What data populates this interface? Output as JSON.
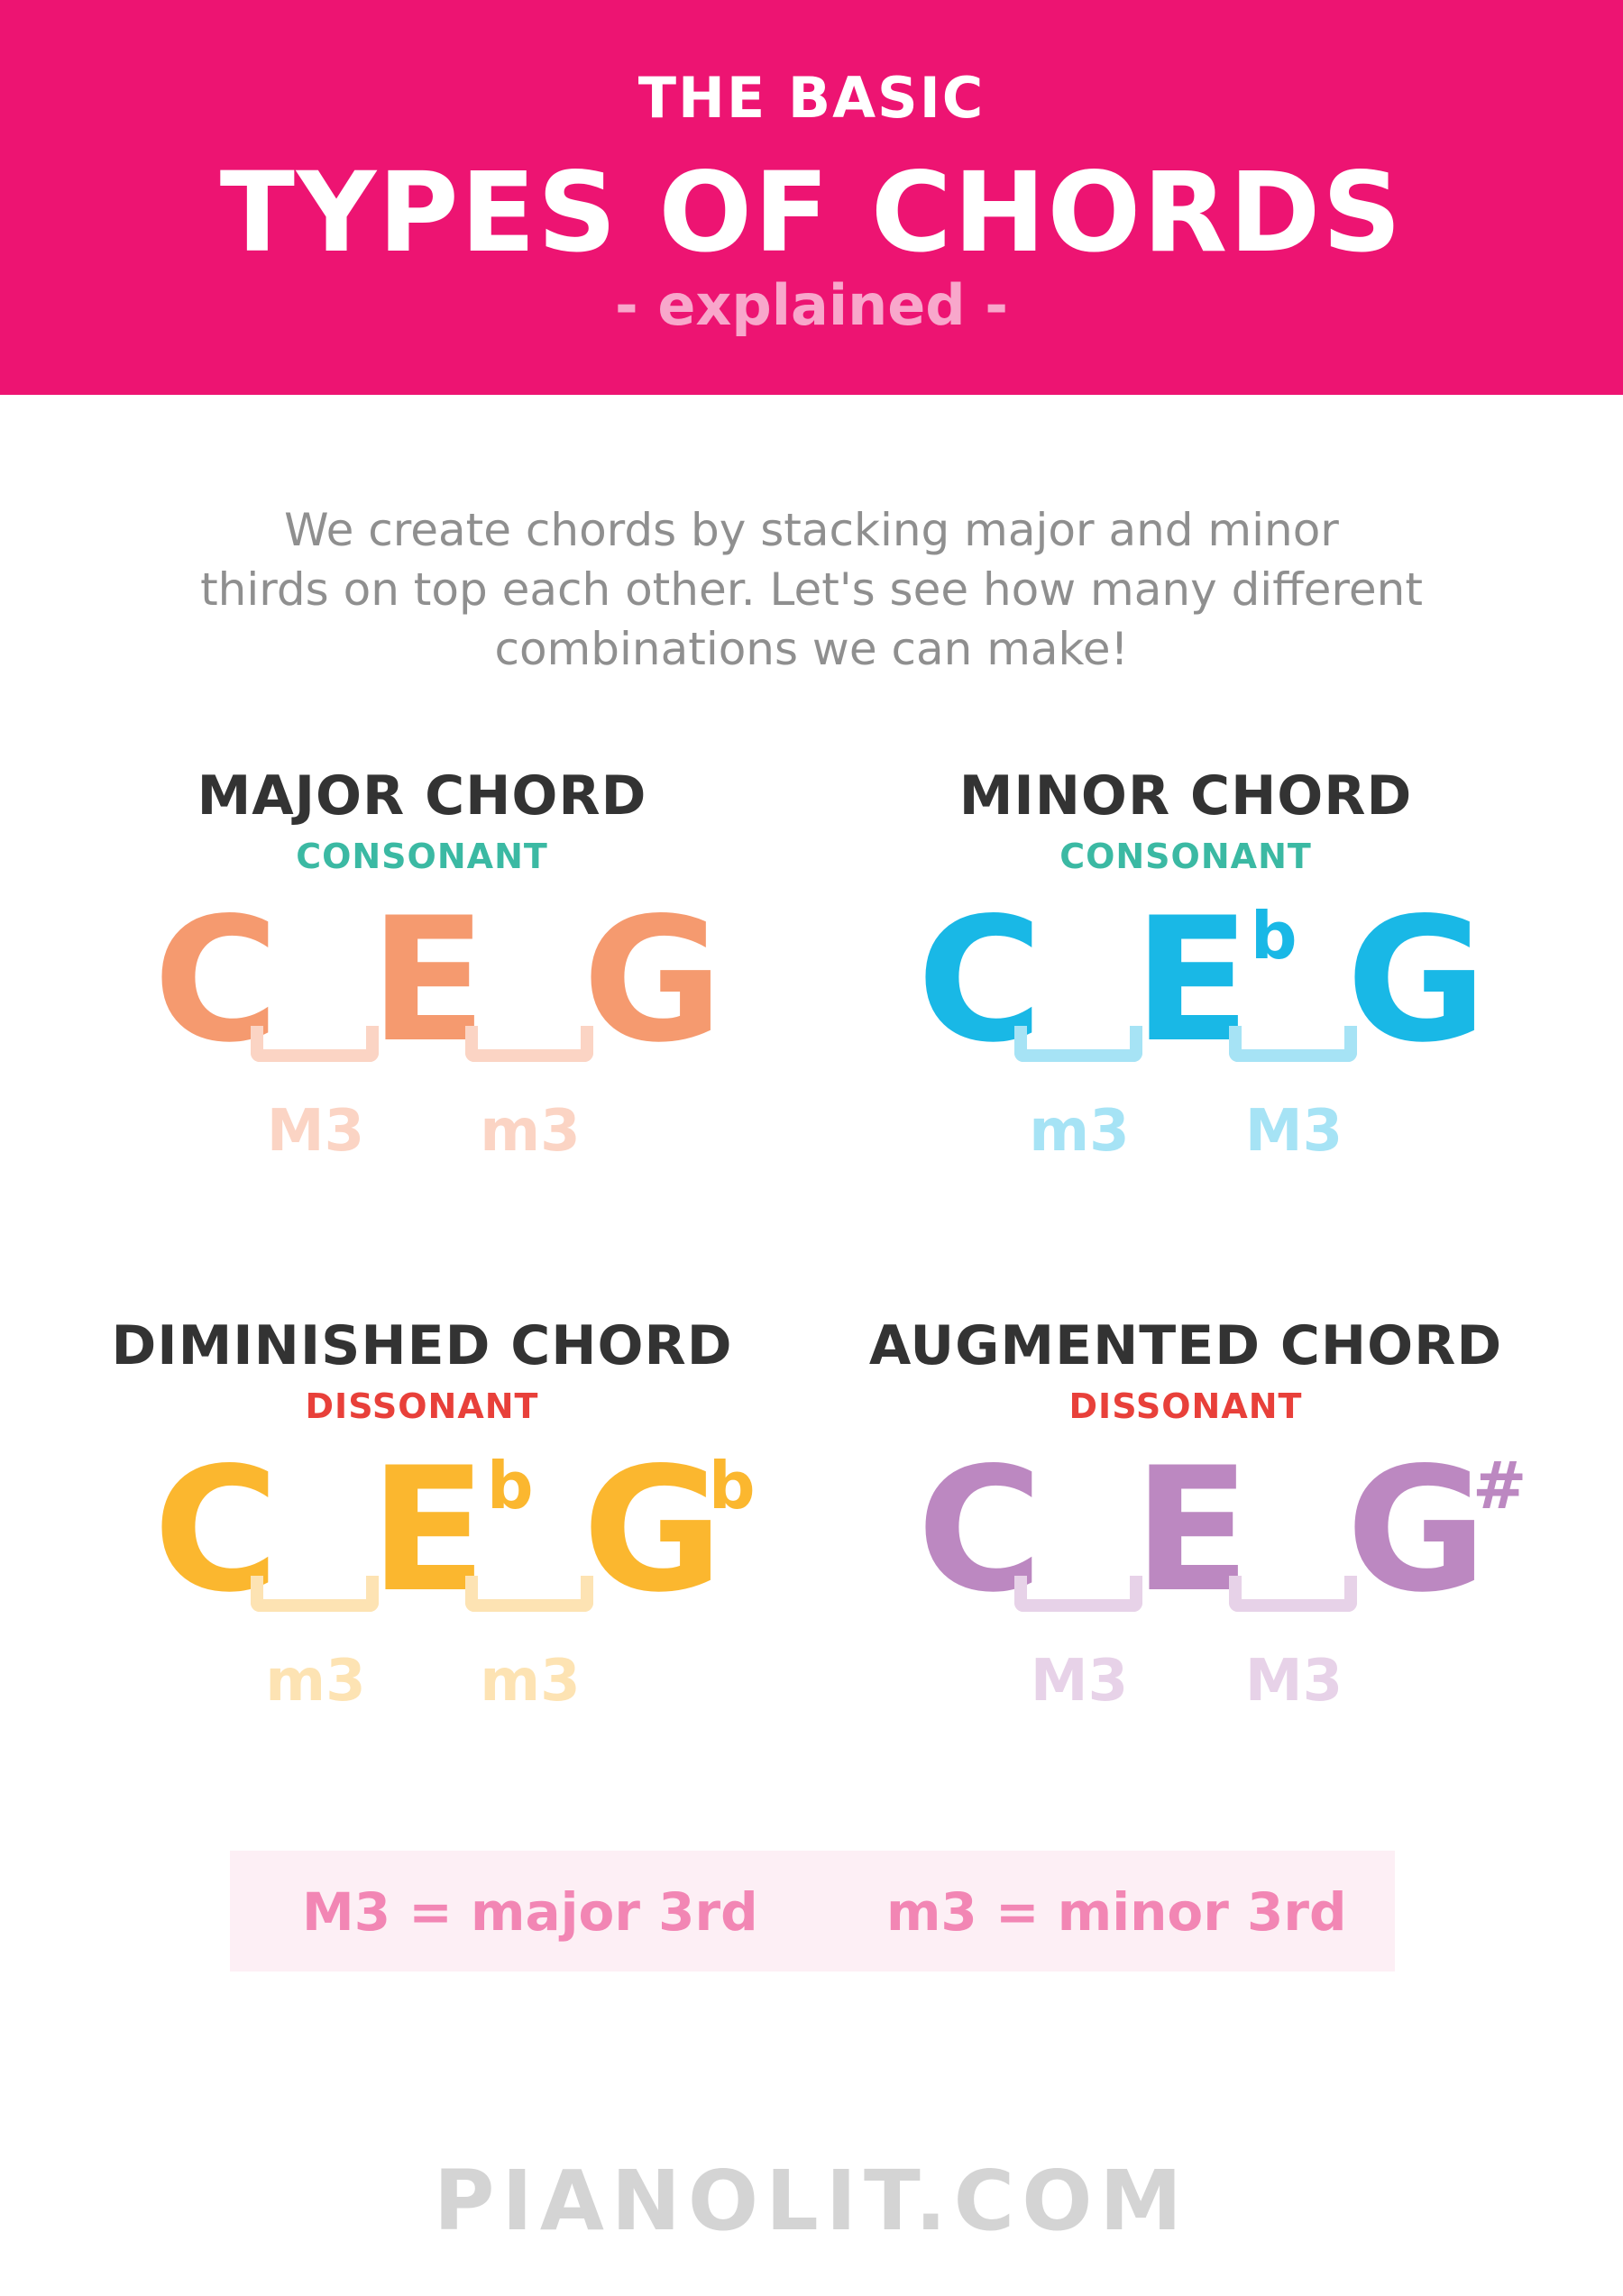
{
  "header": {
    "pretitle": "THE BASIC",
    "title": "TYPES OF CHORDS",
    "subtitle": "- explained -"
  },
  "intro": {
    "lines": [
      "We create chords by stacking major and minor",
      "thirds on top each other. Let's see how many different",
      "combinations we can make!"
    ]
  },
  "chords": [
    {
      "name": "MAJOR CHORD",
      "quality": "CONSONANT",
      "quality_color": "#3BB9A3",
      "note_color": "#F59A6F",
      "interval_color": "#FBD4C4",
      "notes": [
        "C",
        "E",
        "G"
      ],
      "accidentals": [
        "",
        "",
        ""
      ],
      "intervals": [
        "M3",
        "m3"
      ]
    },
    {
      "name": "MINOR CHORD",
      "quality": "CONSONANT",
      "quality_color": "#3BB9A3",
      "note_color": "#19B8E6",
      "interval_color": "#A6E3F5",
      "notes": [
        "C",
        "E",
        "G"
      ],
      "accidentals": [
        "",
        "b",
        ""
      ],
      "intervals": [
        "m3",
        "M3"
      ]
    },
    {
      "name": "DIMINISHED CHORD",
      "quality": "DISSONANT",
      "quality_color": "#E8403A",
      "note_color": "#FBB72F",
      "interval_color": "#FDE3B3",
      "notes": [
        "C",
        "E",
        "G"
      ],
      "accidentals": [
        "",
        "b",
        "b"
      ],
      "intervals": [
        "m3",
        "m3"
      ]
    },
    {
      "name": "AUGMENTED CHORD",
      "quality": "DISSONANT",
      "quality_color": "#E8403A",
      "note_color": "#BC88C1",
      "interval_color": "#E7D2E8",
      "notes": [
        "C",
        "E",
        "G"
      ],
      "accidentals": [
        "",
        "",
        "#"
      ],
      "intervals": [
        "M3",
        "M3"
      ]
    }
  ],
  "legend": {
    "major": "M3 = major 3rd",
    "minor": "m3 = minor 3rd"
  },
  "footer": "PIANOLIT.COM"
}
